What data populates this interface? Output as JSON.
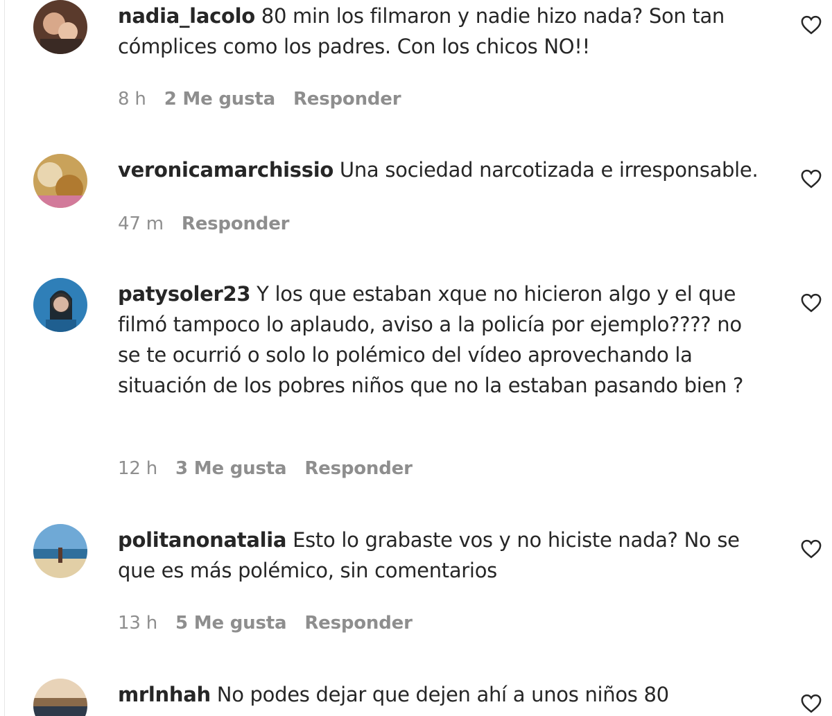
{
  "comments": [
    {
      "username": "nadia_lacolo",
      "text": "80 min los filmaron y nadie hizo nada? Son tan cómplices como los padres. Con los chicos NO!!",
      "time": "8 h",
      "likes": "2 Me gusta",
      "reply": "Responder"
    },
    {
      "username": "veronicamarchissio",
      "text": "Una sociedad narcotizada e irresponsable.",
      "time": "47 m",
      "likes": "",
      "reply": "Responder"
    },
    {
      "username": "patysoler23",
      "text": "Y los que estaban xque no hicieron algo y el que filmó tampoco lo aplaudo, aviso a la policía por ejemplo???? no se te ocurrió o solo lo polémico del vídeo aprovechando la situación de los pobres niños que no la estaban pasando bien ?",
      "time": "12 h",
      "likes": "3 Me gusta",
      "reply": "Responder"
    },
    {
      "username": "politanonatalia",
      "text": "Esto lo grabaste vos y no hiciste nada? No se que es más polémico, sin comentarios",
      "time": "13 h",
      "likes": "5 Me gusta",
      "reply": "Responder"
    },
    {
      "username": "mrlnhah",
      "text": "No podes dejar que dejen ahí a unos niños 80",
      "time": "",
      "likes": "",
      "reply": ""
    }
  ],
  "icons": {
    "like": "heart-outline-icon"
  },
  "colors": {
    "text": "#262626",
    "meta": "#8e8e8e"
  }
}
